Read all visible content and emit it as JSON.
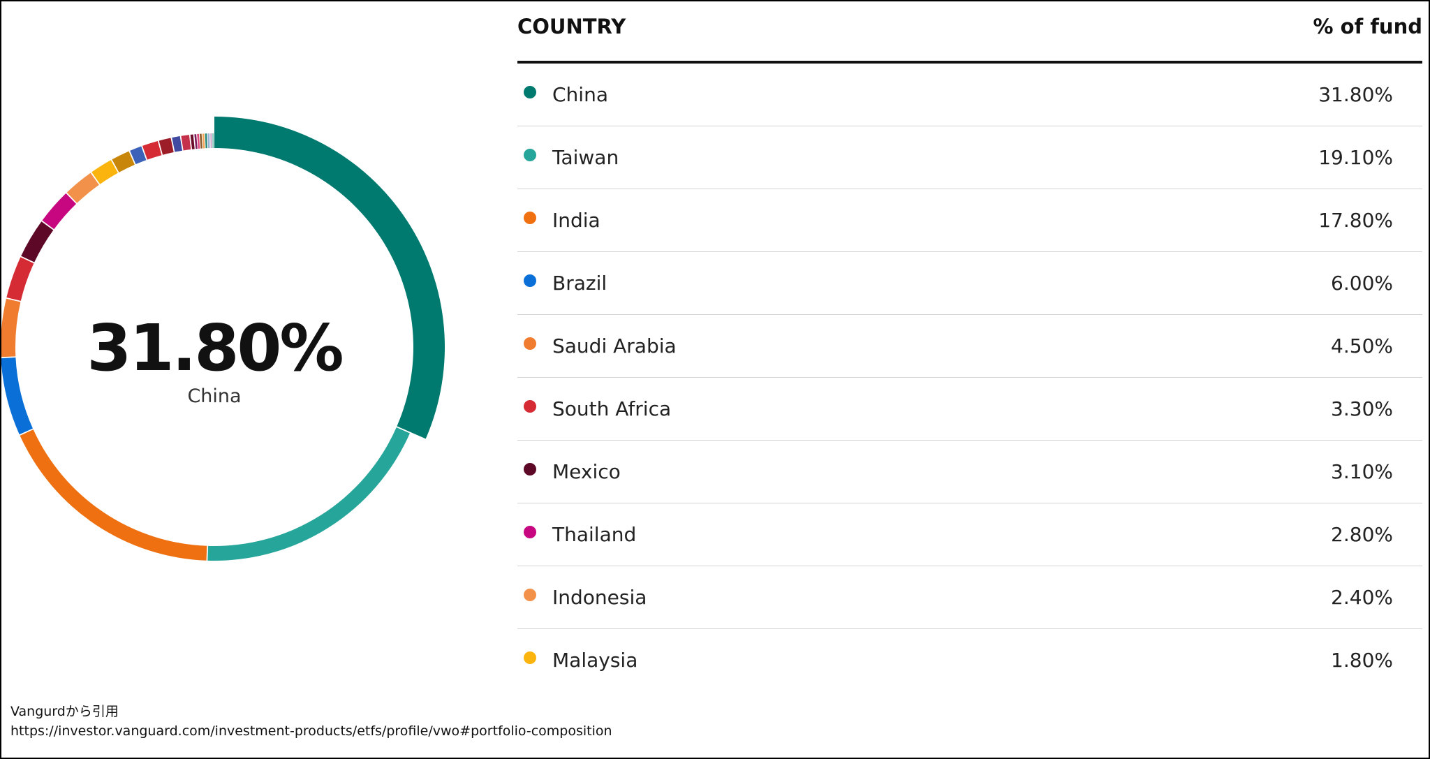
{
  "chart_data": {
    "type": "pie",
    "variant": "donut",
    "center_value": "31.80%",
    "center_label": "China",
    "column_headers": [
      "COUNTRY",
      "% of fund"
    ],
    "categories": [
      "China",
      "Taiwan",
      "India",
      "Brazil",
      "Saudi Arabia",
      "South Africa",
      "Mexico",
      "Thailand",
      "Indonesia",
      "Malaysia"
    ],
    "value_labels": [
      "31.80%",
      "19.10%",
      "17.80%",
      "6.00%",
      "4.50%",
      "3.30%",
      "3.10%",
      "2.80%",
      "2.40%",
      "1.80%"
    ],
    "values": [
      31.8,
      19.1,
      17.8,
      6.0,
      4.5,
      3.3,
      3.1,
      2.8,
      2.4,
      1.8
    ],
    "colors": [
      "#00796f",
      "#26a69a",
      "#ee7011",
      "#0a6fd6",
      "#f07c30",
      "#d52b34",
      "#5e0827",
      "#c7077f",
      "#f2914a",
      "#fbb40d"
    ],
    "highlighted": "China",
    "other_segments": {
      "values": [
        1.5,
        1.0,
        1.3,
        1.0,
        0.7,
        0.7,
        0.3,
        0.2,
        0.2,
        0.2,
        0.2,
        0.2,
        0.2,
        0.15,
        0.15
      ],
      "colors": [
        "#c8870a",
        "#3b62b8",
        "#d52b34",
        "#9c1c28",
        "#3f4aa0",
        "#c5304a",
        "#6b0d2a",
        "#7a1a5a",
        "#e0467a",
        "#8a5a2c",
        "#f2a65a",
        "#2a8a7a",
        "#9bb3d8",
        "#c9a0c4",
        "#7fc3b8"
      ]
    }
  },
  "footer": {
    "source": "Vangurdから引用",
    "url": "https://investor.vanguard.com/investment-products/etfs/profile/vwo#portfolio-composition"
  }
}
